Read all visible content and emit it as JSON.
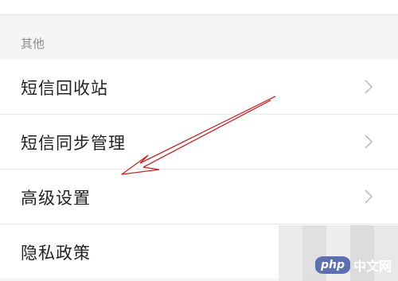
{
  "section": {
    "label": "其他"
  },
  "menu": {
    "items": [
      {
        "label": "短信回收站"
      },
      {
        "label": "短信同步管理"
      },
      {
        "label": "高级设置"
      },
      {
        "label": "隐私政策"
      }
    ]
  },
  "watermark": {
    "logo_text": "php",
    "site_text": "中文网"
  },
  "colors": {
    "background": "#f5f5f5",
    "row_background": "#ffffff",
    "label_text": "#222222",
    "section_text": "#8c8c8c",
    "chevron": "#bdbdbd",
    "annotation_arrow": "#c62828",
    "watermark_badge": "#5b6fb3"
  },
  "icons": {
    "chevron": "chevron-right-icon",
    "annotation": "red-arrow-annotation"
  }
}
